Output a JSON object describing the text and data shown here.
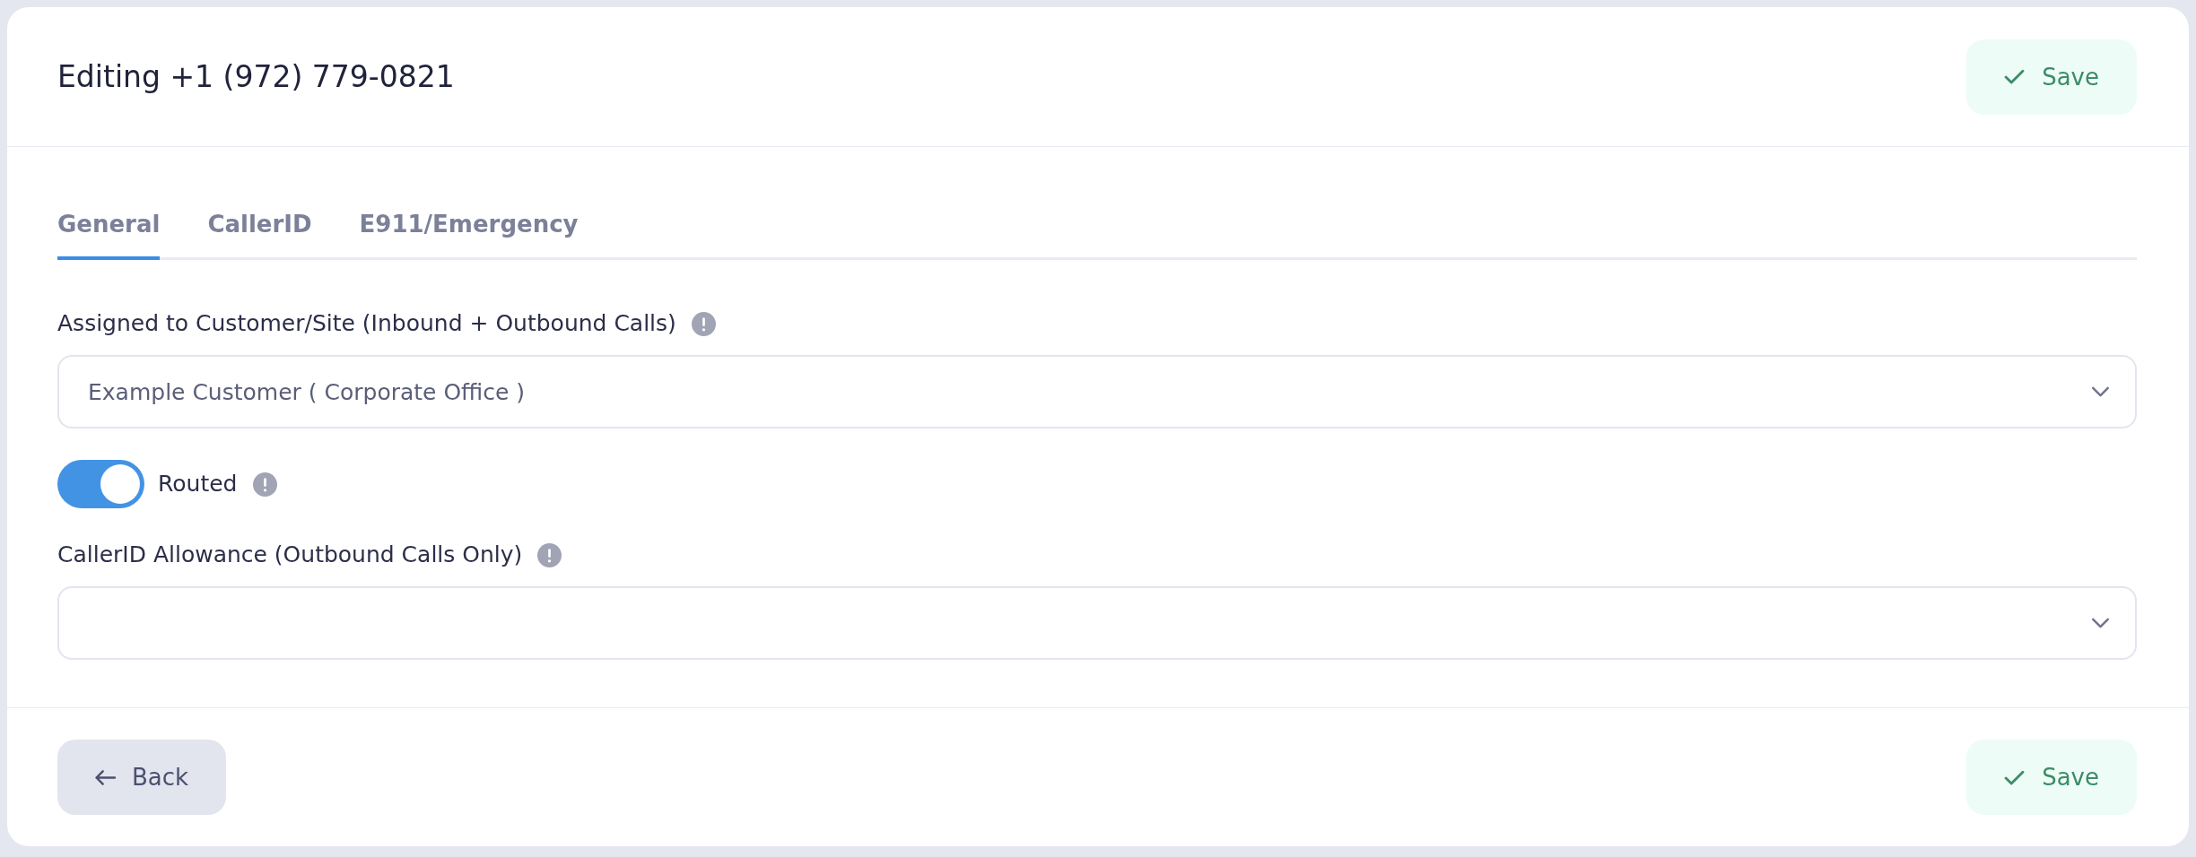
{
  "header": {
    "title": "Editing +1 (972) 779-0821",
    "buttons": [
      {
        "kind": "save",
        "label": "Save"
      }
    ]
  },
  "tabs": [
    {
      "label": "General",
      "selected": true
    },
    {
      "label": "CallerID",
      "selected": false
    },
    {
      "label": "E911/Emergency",
      "selected": false
    }
  ],
  "form": {
    "fields": [
      {
        "kind": "select",
        "label": "Assigned to Customer/Site (Inbound + Outbound Calls)",
        "value": "Example Customer ( Corporate Office )"
      },
      {
        "kind": "toggle",
        "label": "Routed",
        "on": true
      },
      {
        "kind": "select",
        "label": "CallerID Allowance (Outbound Calls Only)"
      }
    ]
  },
  "footer": {
    "buttons": [
      {
        "kind": "back",
        "label": "Back"
      },
      {
        "kind": "save",
        "label": "Save"
      }
    ]
  }
}
